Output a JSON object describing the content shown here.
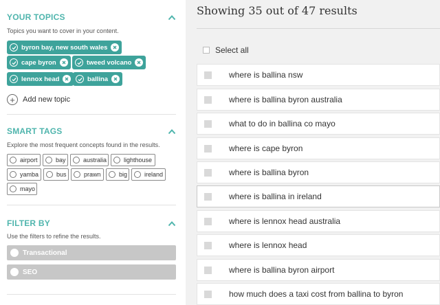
{
  "topics": {
    "title": "YOUR TOPICS",
    "description": "Topics you want to cover in your content.",
    "chips": [
      "byron bay, new south wales",
      "cape byron",
      "tweed volcano",
      "lennox head",
      "ballina"
    ],
    "add_label": "Add new topic"
  },
  "smart_tags": {
    "title": "SMART TAGS",
    "description": "Explore the most frequent concepts found in the results.",
    "tags": [
      "airport",
      "bay",
      "australia",
      "lighthouse",
      "yamba",
      "bus",
      "prawn",
      "big",
      "ireland",
      "mayo"
    ]
  },
  "filter_by": {
    "title": "FILTER BY",
    "description": "Use the filters to refine the results.",
    "filters": [
      "Transactional",
      "SEO"
    ]
  },
  "results": {
    "heading": "Showing 35 out of 47 results",
    "select_all": "Select all",
    "items": [
      "where is ballina nsw",
      "where is ballina byron australia",
      "what to do in ballina co mayo",
      "where is cape byron",
      "where is ballina byron",
      "where is ballina in ireland",
      "where is lennox head australia",
      "where is lennox head",
      "where is ballina byron airport",
      "how much does a taxi cost from ballina to byron"
    ]
  },
  "colors": {
    "accent": "#4fb5ad",
    "chip": "#3ea39b",
    "filter": "#c7c7c7",
    "main_bg": "#f1f1f1"
  }
}
